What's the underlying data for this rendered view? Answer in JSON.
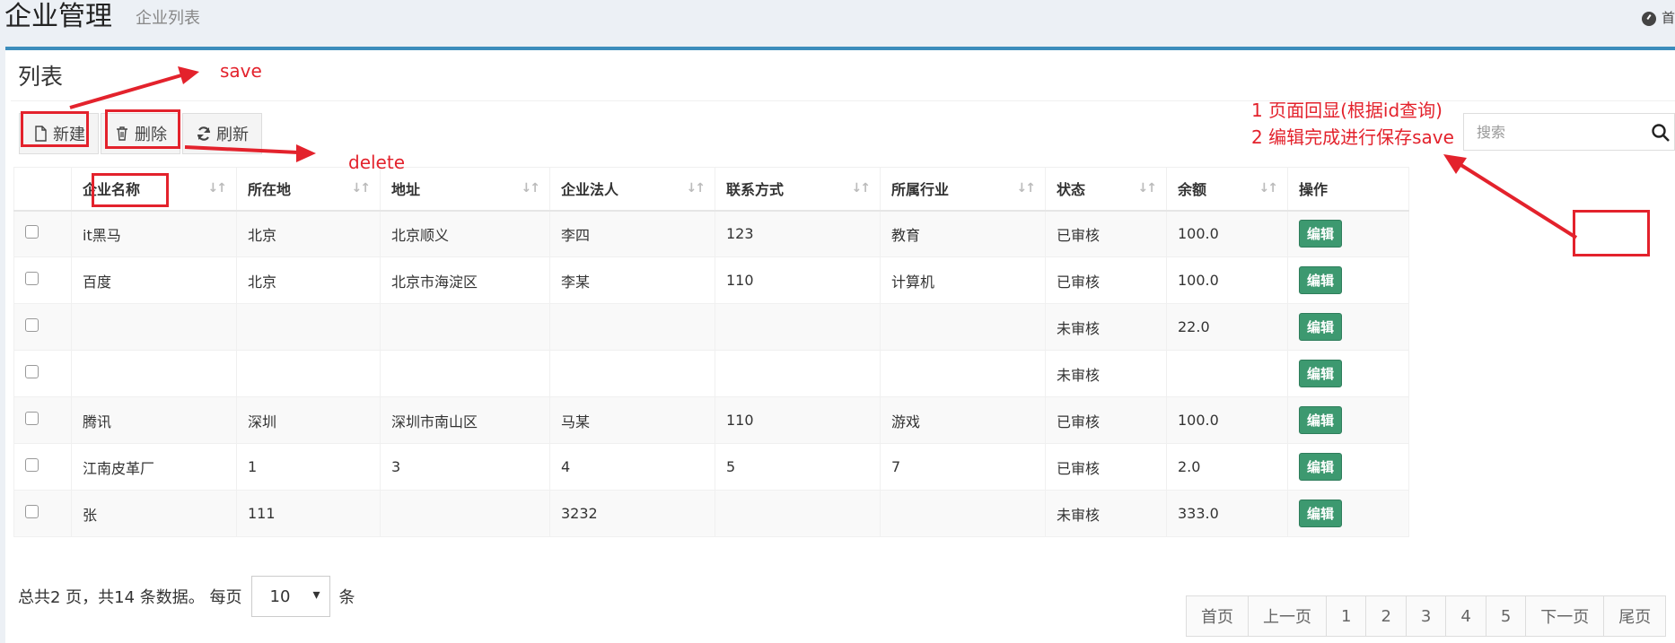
{
  "header": {
    "title": "企业管理",
    "subtitle": "企业列表",
    "home_label": "首"
  },
  "box": {
    "title": "列表"
  },
  "toolbar": {
    "new_label": "新建",
    "delete_label": "删除",
    "refresh_label": "刷新"
  },
  "search": {
    "placeholder": "搜索"
  },
  "table": {
    "columns": [
      "企业名称",
      "所在地",
      "地址",
      "企业法人",
      "联系方式",
      "所属行业",
      "状态",
      "余额",
      "操作"
    ],
    "rows": [
      {
        "name": "it黑马",
        "city": "北京",
        "address": "北京顺义",
        "legal": "李四",
        "contact": "123",
        "industry": "教育",
        "status": "已审核",
        "balance": "100.0",
        "op": "编辑"
      },
      {
        "name": "百度",
        "city": "北京",
        "address": "北京市海淀区",
        "legal": "李某",
        "contact": "110",
        "industry": "计算机",
        "status": "已审核",
        "balance": "100.0",
        "op": "编辑"
      },
      {
        "name": "",
        "city": "",
        "address": "",
        "legal": "",
        "contact": "",
        "industry": "",
        "status": "未审核",
        "balance": "22.0",
        "op": "编辑"
      },
      {
        "name": "",
        "city": "",
        "address": "",
        "legal": "",
        "contact": "",
        "industry": "",
        "status": "未审核",
        "balance": "",
        "op": "编辑"
      },
      {
        "name": "腾讯",
        "city": "深圳",
        "address": "深圳市南山区",
        "legal": "马某",
        "contact": "110",
        "industry": "游戏",
        "status": "已审核",
        "balance": "100.0",
        "op": "编辑"
      },
      {
        "name": "江南皮革厂",
        "city": "1",
        "address": "3",
        "legal": "4",
        "contact": "5",
        "industry": "7",
        "status": "已审核",
        "balance": "2.0",
        "op": "编辑"
      },
      {
        "name": "张",
        "city": "111",
        "address": "",
        "legal": "3232",
        "contact": "",
        "industry": "",
        "status": "未审核",
        "balance": "333.0",
        "op": "编辑"
      }
    ]
  },
  "footer": {
    "summary": "总共2 页，共14 条数据。 每页",
    "page_size": "10",
    "unit": "条"
  },
  "pagination": [
    "首页",
    "上一页",
    "1",
    "2",
    "3",
    "4",
    "5",
    "下一页",
    "尾页"
  ],
  "annotations": {
    "save": "save",
    "delete": "delete",
    "note_line1": "1 页面回显(根据id查询)",
    "note_line2": "2 编辑完成进行保存save"
  },
  "colors": {
    "accent": "#3c8dbc",
    "edit_button": "#3d9970",
    "annotation": "#e3222c"
  }
}
